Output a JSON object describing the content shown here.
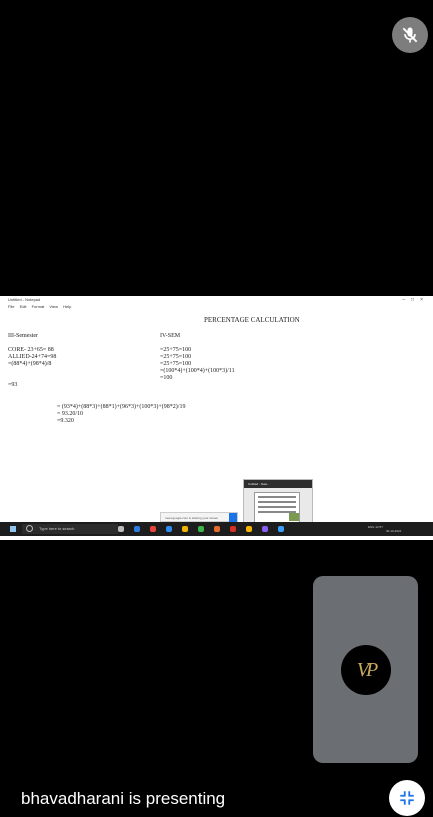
{
  "participant": {
    "mic_state": "muted",
    "mic_icon": "mic-off-icon"
  },
  "shared_screen": {
    "window_title": "Untitled - Notepad",
    "window_controls": [
      "–",
      "□",
      "×"
    ],
    "menu": [
      "File",
      "Edit",
      "Format",
      "View",
      "Help"
    ],
    "document": {
      "heading": "PERCENTAGE CALCULATION",
      "lines": [
        "III-Semester",
        "IV-SEM",
        "CORE- 23+65= 88",
        "=25+75=100",
        "ALLIED-24+74=98",
        "=25+75=100",
        "=(88*4)+(98*4)/8",
        "=25+75=100",
        "=(100*4)+(100*4)+(100*3)/11",
        "=100",
        "=93",
        "= (93*4)+(88*3)+(88*1)+(96*3)+(100*3)+(98*2)/19",
        "= 93.20/10",
        "=9.320"
      ]
    },
    "notepad_preview_title": "Untitled - Note..",
    "toast_text": "meet.google.com is sharing your screen",
    "taskbar": {
      "search_placeholder": "Type here to search",
      "tray_text": "ENG",
      "time": "12:57",
      "date": "30-10-2021",
      "app_colors": [
        "#bbbbbb",
        "#2f7de1",
        "#e8453c",
        "#2d8cf0",
        "#f0b400",
        "#3bb54a",
        "#e56b2d",
        "#d93025",
        "#f4b400",
        "#8a5cf6",
        "#3aa0ff"
      ]
    }
  },
  "self_view": {
    "avatar_initials": "VP",
    "avatar_bg": "#000000",
    "avatar_fg": "#c9a95c"
  },
  "presenter_banner": {
    "text": "bhavadharani is presenting"
  },
  "controls": {
    "fullscreen_icon": "exit-fullscreen-icon"
  }
}
